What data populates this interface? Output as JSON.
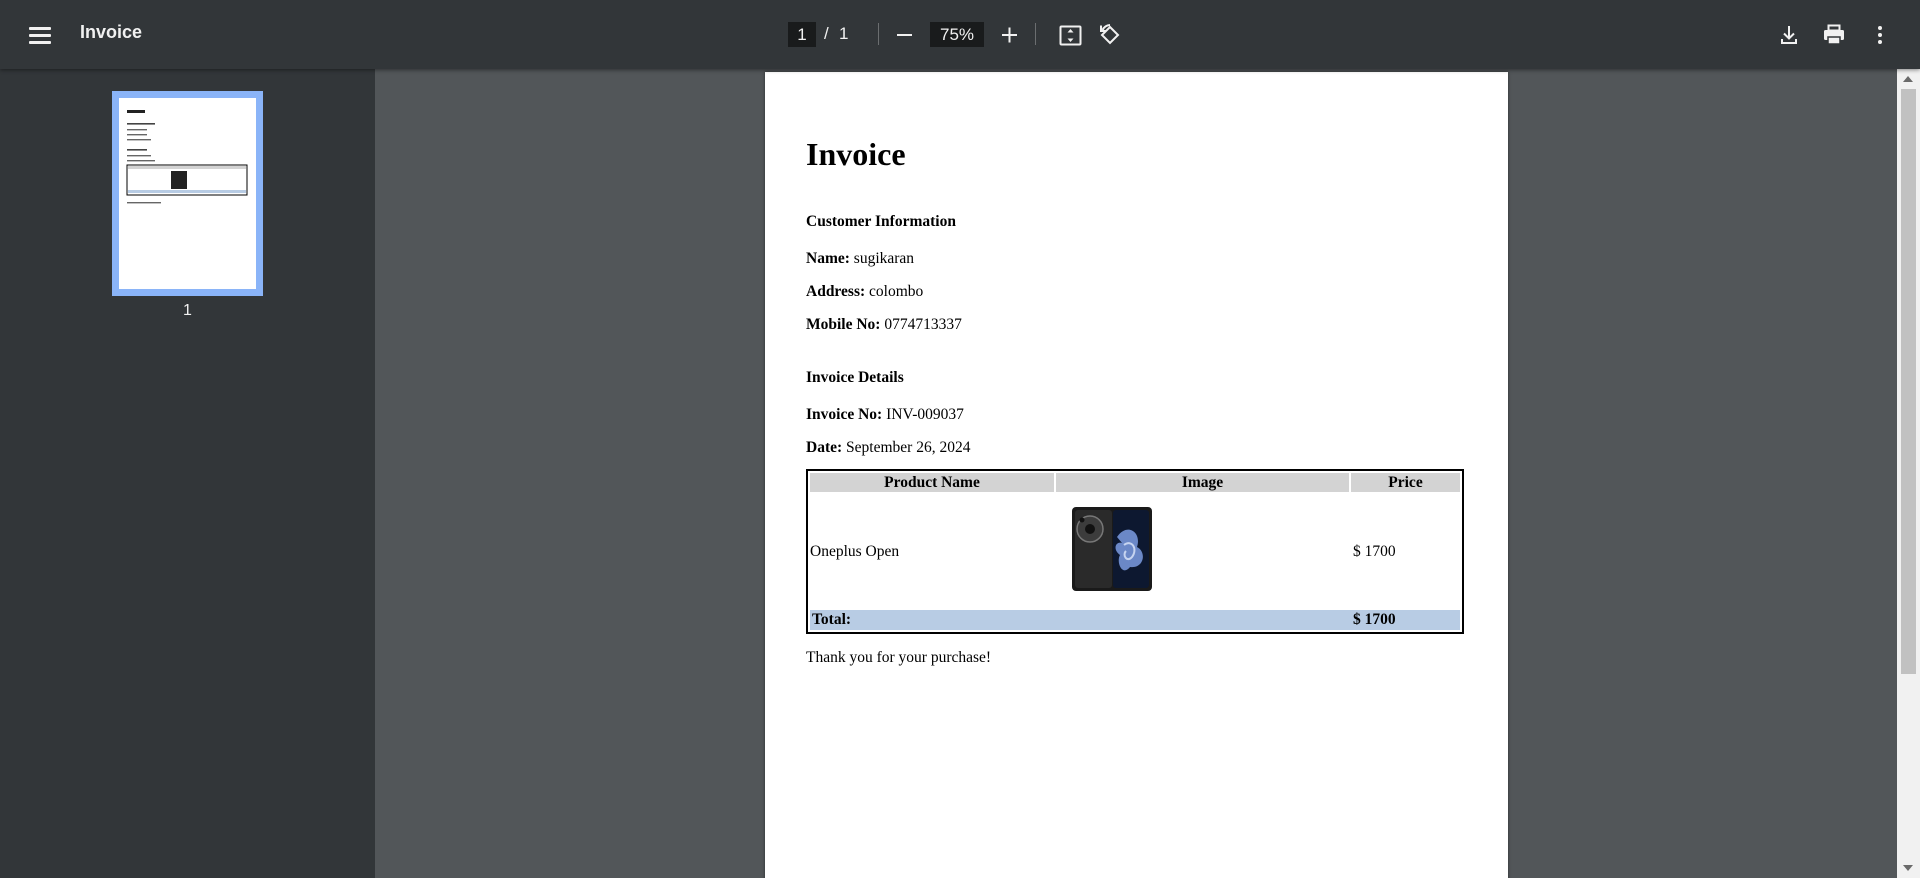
{
  "toolbar": {
    "title": "Invoice",
    "current_page": "1",
    "page_separator": "/",
    "total_pages": "1",
    "zoom": "75%",
    "icons": [
      "menu-icon",
      "zoom-out-icon",
      "zoom-in-icon",
      "fit-page-icon",
      "rotate-icon",
      "download-icon",
      "print-icon",
      "more-vert-icon"
    ]
  },
  "sidebar": {
    "thumbnail_label": "1"
  },
  "document": {
    "title": "Invoice",
    "customer_heading": "Customer Information",
    "name_label": "Name:",
    "name_value": "sugikaran",
    "address_label": "Address:",
    "address_value": "colombo",
    "mobile_label": "Mobile No:",
    "mobile_value": "0774713337",
    "details_heading": "Invoice Details",
    "invoice_no_label": "Invoice No:",
    "invoice_no_value": "INV-009037",
    "date_label": "Date:",
    "date_value": "September 26, 2024",
    "table": {
      "headers": [
        "Product Name",
        "Image",
        "Price"
      ],
      "rows": [
        {
          "product": "Oneplus Open",
          "price": "$ 1700"
        }
      ],
      "total_label": "Total:",
      "total_value": "$ 1700"
    },
    "footer": "Thank you for your purchase!"
  }
}
